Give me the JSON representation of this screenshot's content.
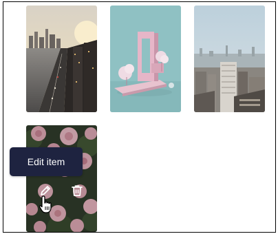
{
  "gallery": {
    "items": [
      {
        "id": "tile-1",
        "image": "city-harbor-highway-photo"
      },
      {
        "id": "tile-2",
        "image": "pink-arch-sculpture-photo"
      },
      {
        "id": "tile-3",
        "image": "city-skyline-aerial-photo"
      },
      {
        "id": "tile-4",
        "image": "pink-roses-photo"
      }
    ],
    "hovered_item_actions": {
      "edit_icon": "pencil-icon",
      "delete_icon": "trash-icon"
    }
  },
  "tooltip": {
    "text": "Edit item"
  },
  "colors": {
    "tooltip_bg": "#1e2340",
    "tooltip_text": "#ffffff",
    "action_icon": "#ffffff"
  },
  "cursor": {
    "type": "pointer-hand"
  }
}
